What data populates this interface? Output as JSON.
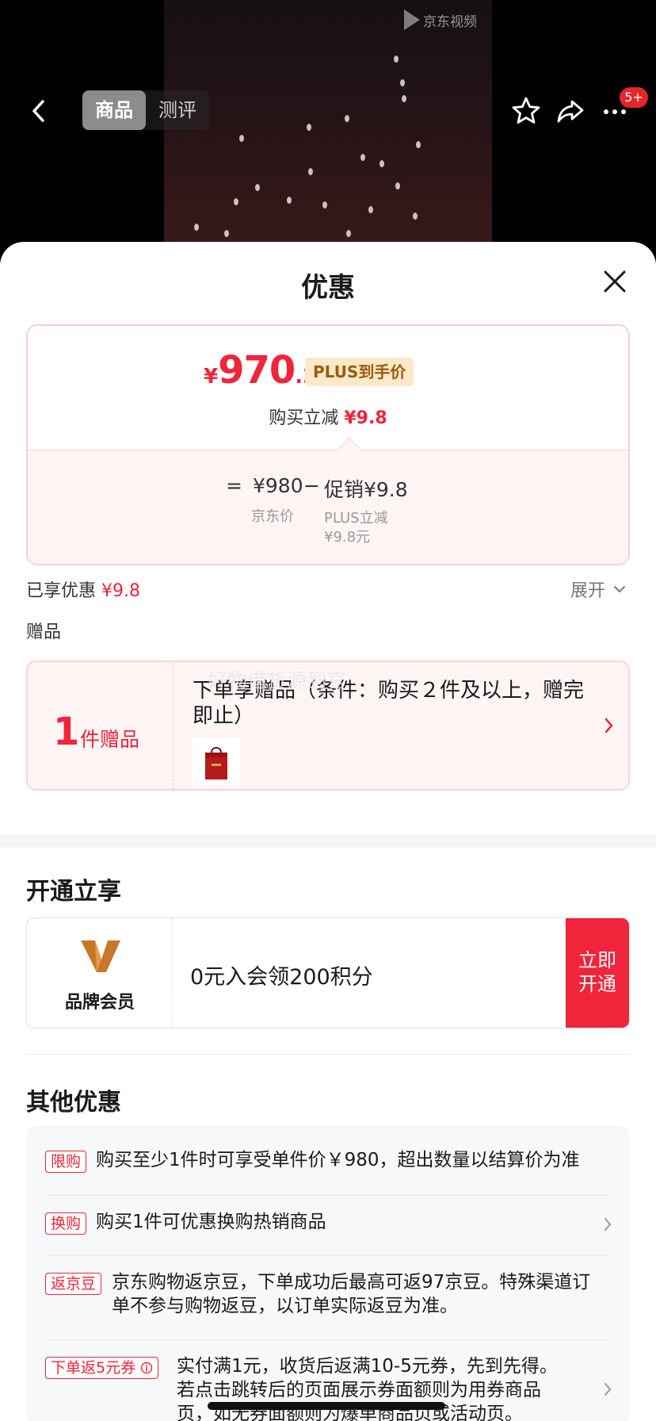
{
  "video": {
    "watermark": "京东视频"
  },
  "topbar": {
    "tabs": [
      {
        "label": "商品",
        "active": true
      },
      {
        "label": "测评",
        "active": false
      }
    ],
    "cart_badge": "5+"
  },
  "sheet": {
    "title": "优惠",
    "price": {
      "currency": "¥",
      "integer": "970",
      "decimal": ".2",
      "plus_tag": "PLUS到手价"
    },
    "reduce": {
      "label": "购买立减",
      "amount": "¥9.8"
    },
    "formula": {
      "equals": "=",
      "jd_price": "¥980",
      "minus": "−",
      "promo": "促销¥9.8",
      "jd_price_label": "京东价",
      "plus_label_line1": "PLUS立减",
      "plus_label_line2": "¥9.8元"
    },
    "enjoyed": {
      "label": "已享优惠",
      "amount": "¥9.8"
    },
    "expand_label": "展开",
    "gift_section_label": "赠品",
    "gift": {
      "count": "1",
      "unit": "件赠品",
      "text": "下单享赠品（条件：购买２件及以上，赠完即止）",
      "overlay": "好物借货源到官"
    },
    "open_section_title": "开通立享",
    "member": {
      "label": "品牌会员",
      "text": "0元入会领200积分",
      "button_line1": "立即",
      "button_line2": "开通"
    },
    "other_section_title": "其他优惠",
    "promos": [
      {
        "tag": "限购",
        "text": "购买至少1件时可享受单件价￥980，超出数量以结算价为准"
      },
      {
        "tag": "换购",
        "text": "购买1件可优惠换购热销商品"
      },
      {
        "tag": "返京豆",
        "text_line1": "京东购物返京豆，下单成功后最高可返97京豆。特殊渠道订",
        "text_line2": "单不参与购物返豆，以订单实际返豆为准。"
      },
      {
        "tag": "下单返5元券",
        "text_line1": "实付满1元，收货后返满10-5元券，先到先得。",
        "text_line2": "若点击跳转后的页面展示券面额则为用券商品",
        "text_line3": "页，如无券面额则为爆单商品页或活动页。"
      }
    ]
  }
}
